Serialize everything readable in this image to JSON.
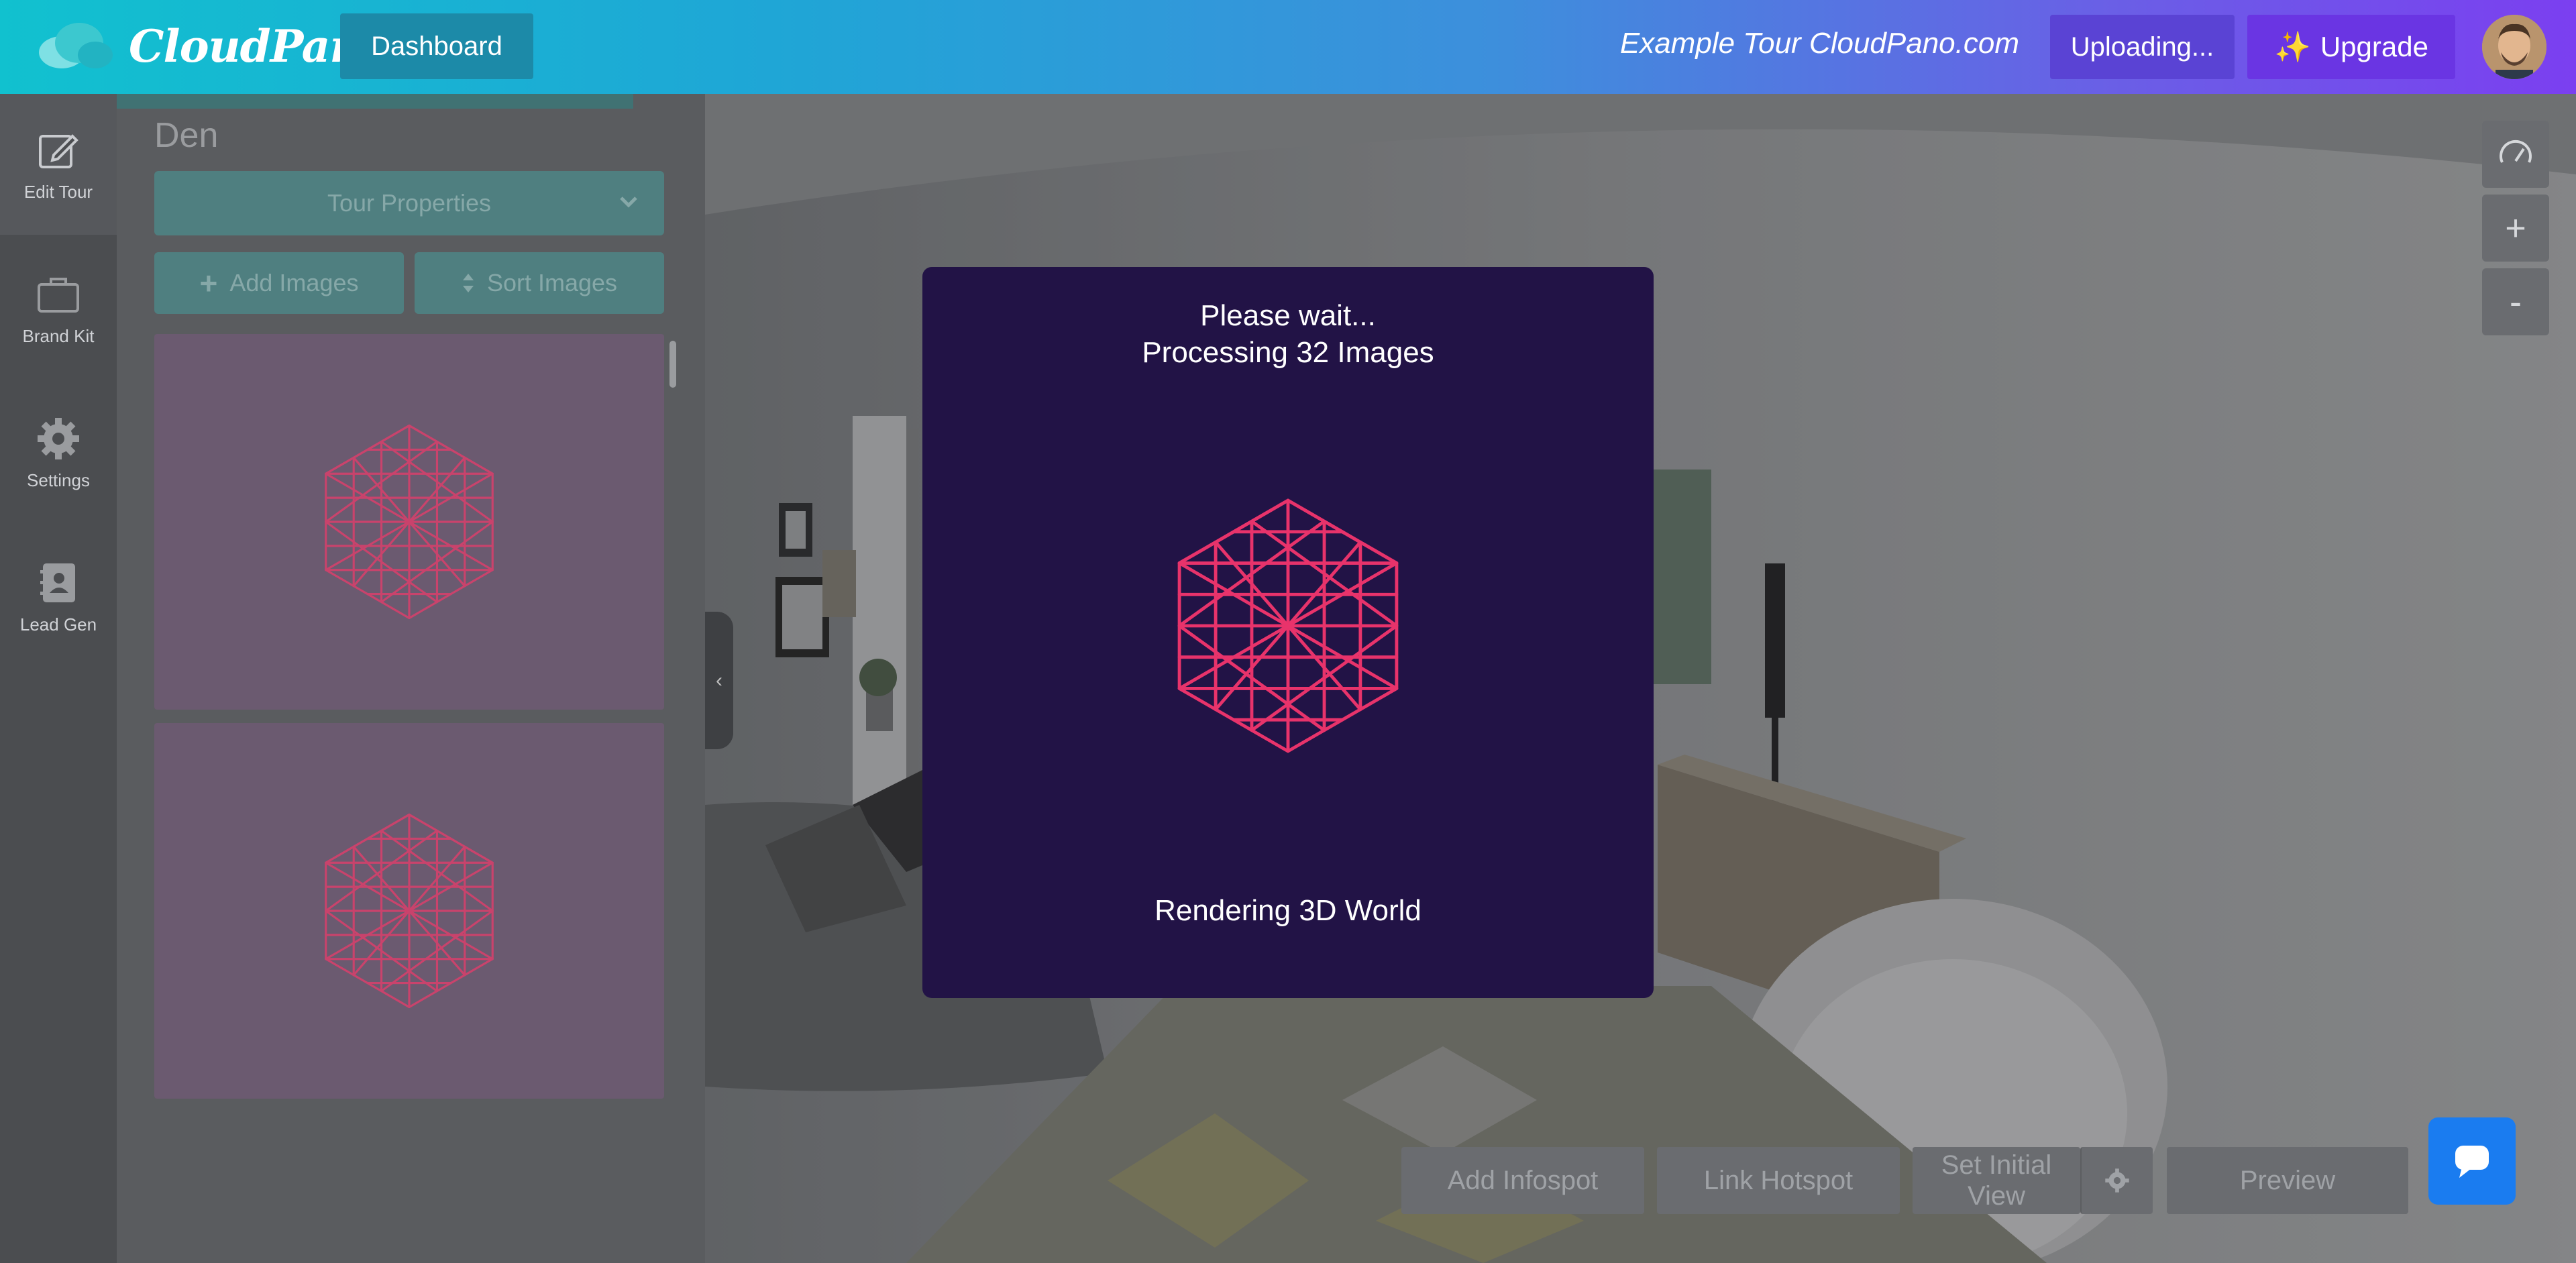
{
  "header": {
    "brand": "CloudPano",
    "dashboard_label": "Dashboard",
    "tour_name": "Example Tour CloudPano.com",
    "uploading_label": "Uploading...",
    "upgrade_label": "Upgrade"
  },
  "rail": {
    "items": [
      {
        "label": "Edit Tour",
        "icon": "edit-icon"
      },
      {
        "label": "Brand Kit",
        "icon": "briefcase-icon"
      },
      {
        "label": "Settings",
        "icon": "gear-icon"
      },
      {
        "label": "Lead Gen",
        "icon": "contact-book-icon"
      }
    ]
  },
  "panel": {
    "section_title": "Den",
    "tour_properties_label": "Tour Properties",
    "add_images_label": "Add Images",
    "sort_images_label": "Sort Images"
  },
  "viewer": {
    "zoom_in_label": "+",
    "zoom_out_label": "-",
    "add_infospot_label": "Add Infospot",
    "link_hotspot_label": "Link Hotspot",
    "set_initial_view_label": "Set Initial View",
    "preview_label": "Preview"
  },
  "modal": {
    "line1": "Please wait...",
    "line2": "Processing 32 Images",
    "status": "Rendering 3D World"
  },
  "colors": {
    "accent_pink": "#e8336b",
    "modal_bg": "#221346",
    "teal_button": "#4f7f80",
    "chat_blue": "#1a7cf0"
  }
}
